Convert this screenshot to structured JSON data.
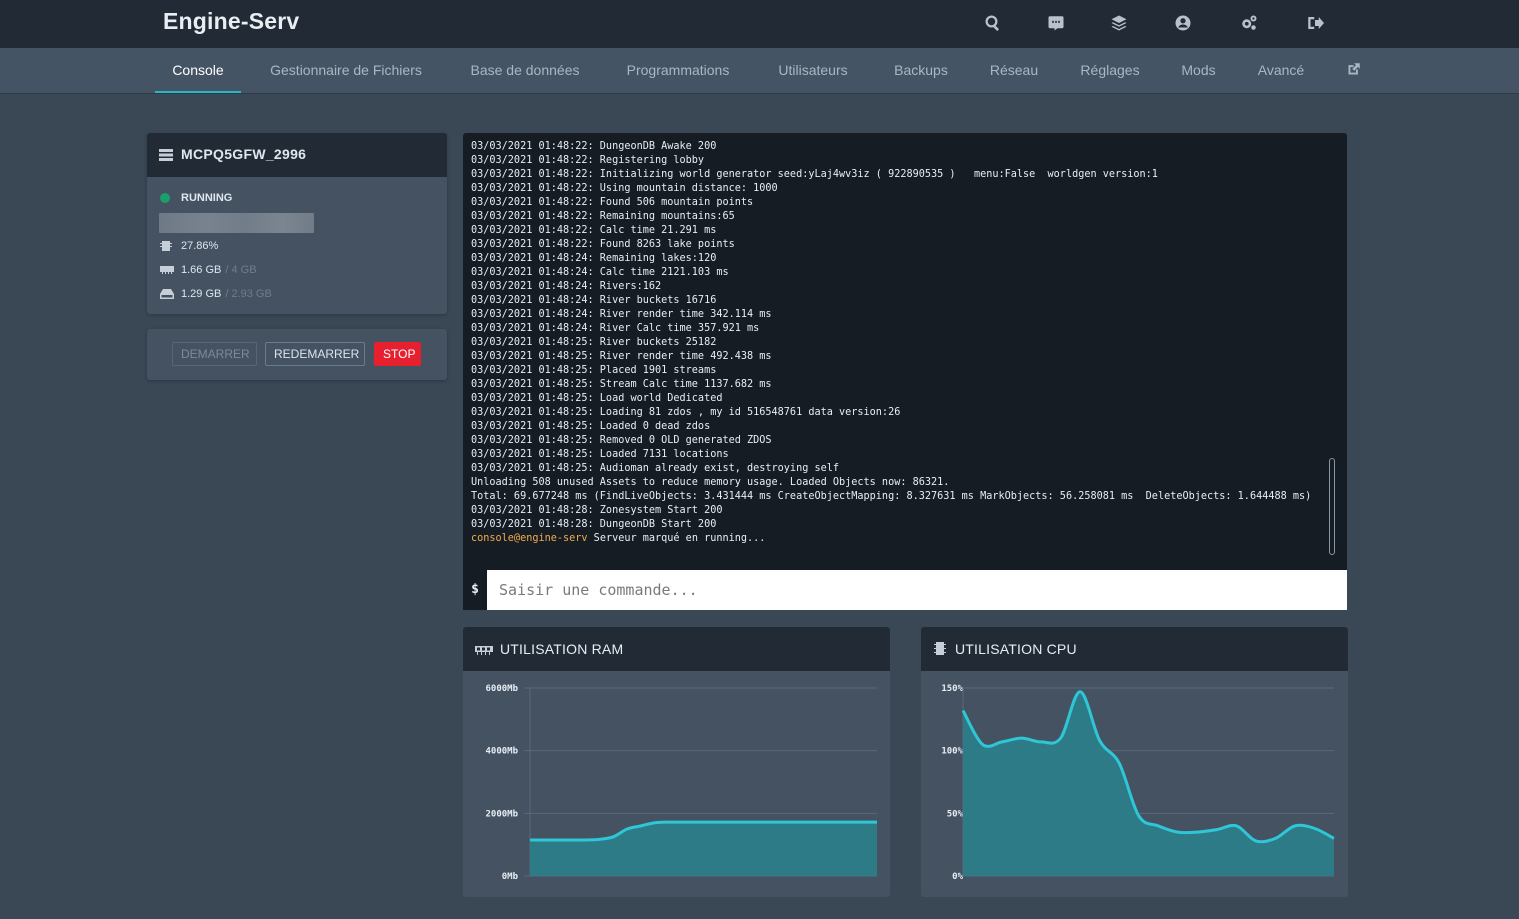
{
  "app": {
    "title": "Engine-Serv"
  },
  "top_icons": [
    "search-icon",
    "chat-icon",
    "layers-icon",
    "user-circle-icon",
    "cogs-icon",
    "sign-out-icon"
  ],
  "nav": {
    "tabs": [
      {
        "label": "Console",
        "active": true
      },
      {
        "label": "Gestionnaire de Fichiers"
      },
      {
        "label": "Base de données"
      },
      {
        "label": "Programmations"
      },
      {
        "label": "Utilisateurs"
      },
      {
        "label": "Backups"
      },
      {
        "label": "Réseau"
      },
      {
        "label": "Réglages"
      },
      {
        "label": "Mods"
      },
      {
        "label": "Avancé"
      }
    ],
    "external_icon": "external-link-icon"
  },
  "server": {
    "name": "MCPQ5GFW_2996",
    "status": "RUNNING",
    "status_color": "#1aa06b",
    "cpu": "27.86%",
    "ram_used": "1.66 GB",
    "ram_total": "/ 4 GB",
    "disk_used": "1.29 GB",
    "disk_total": "/ 2.93 GB"
  },
  "controls": {
    "start": "DEMARRER",
    "restart": "REDEMARRER",
    "stop": "STOP",
    "stop_color": "#e6202f"
  },
  "console": {
    "lines": [
      "03/03/2021 01:48:22: DungeonDB Awake 200",
      "03/03/2021 01:48:22: Registering lobby",
      "03/03/2021 01:48:22: Initializing world generator seed:yLaj4wv3iz ( 922890535 )   menu:False  worldgen version:1",
      "03/03/2021 01:48:22: Using mountain distance: 1000",
      "03/03/2021 01:48:22: Found 506 mountain points",
      "03/03/2021 01:48:22: Remaining mountains:65",
      "03/03/2021 01:48:22: Calc time 21.291 ms",
      "03/03/2021 01:48:22: Found 8263 lake points",
      "03/03/2021 01:48:24: Remaining lakes:120",
      "03/03/2021 01:48:24: Calc time 2121.103 ms",
      "03/03/2021 01:48:24: Rivers:162",
      "03/03/2021 01:48:24: River buckets 16716",
      "03/03/2021 01:48:24: River render time 342.114 ms",
      "03/03/2021 01:48:24: River Calc time 357.921 ms",
      "03/03/2021 01:48:25: River buckets 25182",
      "03/03/2021 01:48:25: River render time 492.438 ms",
      "03/03/2021 01:48:25: Placed 1901 streams",
      "03/03/2021 01:48:25: Stream Calc time 1137.682 ms",
      "03/03/2021 01:48:25: Load world Dedicated",
      "03/03/2021 01:48:25: Loading 81 zdos , my id 516548761 data version:26",
      "03/03/2021 01:48:25: Loaded 0 dead zdos",
      "03/03/2021 01:48:25: Removed 0 OLD generated ZDOS",
      "03/03/2021 01:48:25: Loaded 7131 locations",
      "03/03/2021 01:48:25: Audioman already exist, destroying self",
      "Unloading 508 unused Assets to reduce memory usage. Loaded Objects now: 86321.",
      "Total: 69.677248 ms (FindLiveObjects: 3.431444 ms CreateObjectMapping: 8.327631 ms MarkObjects: 56.258081 ms  DeleteObjects: 1.644488 ms)",
      "03/03/2021 01:48:28: Zonesystem Start 200",
      "03/03/2021 01:48:28: DungeonDB Start 200"
    ],
    "prompt_user": "console@engine-serv",
    "prompt_message": " Serveur marqué en running...",
    "prefix": "$",
    "input_placeholder": "Saisir une commande..."
  },
  "ram_chart": {
    "title": "UTILISATION RAM",
    "icon": "memory-icon"
  },
  "cpu_chart": {
    "title": "UTILISATION CPU",
    "icon": "cpu-icon"
  },
  "chart_data": [
    {
      "type": "area",
      "title": "UTILISATION RAM",
      "yticks": [
        "6000Mb",
        "4000Mb",
        "2000Mb",
        "0Mb"
      ],
      "ylim": [
        0,
        6000
      ],
      "color": "#2fc6d6",
      "values": [
        1150,
        1150,
        1150,
        1150,
        1150,
        1170,
        1250,
        1500,
        1600,
        1700,
        1720,
        1720,
        1720,
        1720,
        1720,
        1720,
        1720,
        1720,
        1720,
        1720,
        1720,
        1720,
        1720,
        1720,
        1720,
        1720
      ]
    },
    {
      "type": "area",
      "title": "UTILISATION CPU",
      "yticks": [
        "150%",
        "100%",
        "50%",
        "0%"
      ],
      "ylim": [
        0,
        150
      ],
      "color": "#2fc6d6",
      "values": [
        132,
        105,
        107,
        110,
        107,
        110,
        147,
        108,
        90,
        48,
        40,
        35,
        35,
        37,
        40,
        28,
        30,
        40,
        38,
        30
      ]
    }
  ]
}
